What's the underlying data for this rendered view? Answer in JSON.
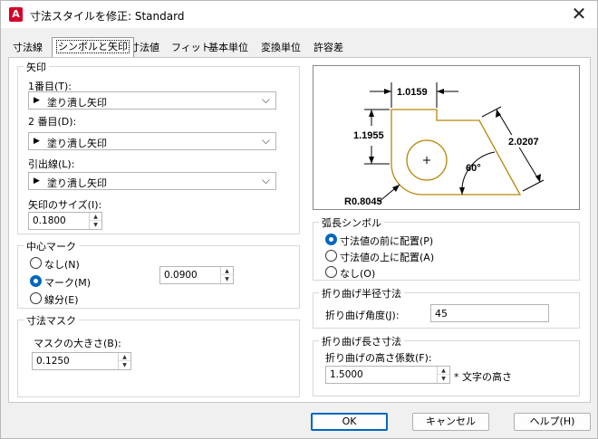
{
  "window": {
    "title": "寸法スタイルを修正: Standard",
    "app_icon": "A"
  },
  "tabs": [
    {
      "label": "寸法線"
    },
    {
      "label": "シンボルと矢印",
      "active": true
    },
    {
      "label": "寸法値"
    },
    {
      "label": "フィット"
    },
    {
      "label": "基本単位"
    },
    {
      "label": "変換単位"
    },
    {
      "label": "許容差"
    }
  ],
  "arrows": {
    "title": "矢印",
    "first_label": "1番目(T):",
    "first_value": "塗り潰し矢印",
    "second_label": "2 番目(D):",
    "second_value": "塗り潰し矢印",
    "leader_label": "引出線(L):",
    "leader_value": "塗り潰し矢印",
    "size_label": "矢印のサイズ(I):",
    "size_value": "0.1800"
  },
  "center_mark": {
    "title": "中心マーク",
    "none": "なし(N)",
    "mark": "マーク(M)",
    "line": "線分(E)",
    "size_value": "0.0900"
  },
  "dim_break": {
    "title": "寸法マスク",
    "size_label": "マスクの大きさ(B):",
    "size_value": "0.1250"
  },
  "preview": {
    "dim1": "1.0159",
    "dim2": "1.1955",
    "dim3": "2.0207",
    "angle": "60°",
    "radius": "R0.8045"
  },
  "arc_symbol": {
    "title": "弧長シンボル",
    "before": "寸法値の前に配置(P)",
    "above": "寸法値の上に配置(A)",
    "none": "なし(O)"
  },
  "jog_radius": {
    "title": "折り曲げ半径寸法",
    "angle_label": "折り曲げ角度(J):",
    "angle_value": "45"
  },
  "jog_linear": {
    "title": "折り曲げ長さ寸法",
    "height_label": "折り曲げの高さ係数(F):",
    "height_value": "1.5000",
    "suffix": "* 文字の高さ"
  },
  "buttons": {
    "ok": "OK",
    "cancel": "キャンセル",
    "help": "ヘルプ(H)"
  },
  "colors": {
    "accent": "#0067c0",
    "app_red": "#d3002a",
    "shape": "#b8860b"
  }
}
